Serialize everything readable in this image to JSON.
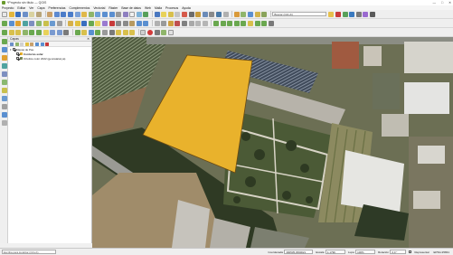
{
  "window": {
    "title": "*Proyecto sin título — QGIS",
    "controls": [
      "—",
      "□",
      "✕"
    ]
  },
  "menu": [
    "Proyecto",
    "Editar",
    "Ver",
    "Capa",
    "Preferencias",
    "Complementos",
    "Vectorial",
    "Ráster",
    "Base de datos",
    "Web",
    "Malla",
    "Procesos",
    "Ayuda"
  ],
  "toolbar": {
    "search_placeholder": "Buscar (Ctrl+K)"
  },
  "panel": {
    "title": "Capas",
    "close": "✕",
    "layers": [
      {
        "name": "Mapas de Pau",
        "checked": true,
        "expanded": true,
        "bold": false,
        "indent": 0,
        "swatch": ""
      },
      {
        "name": "Contorno-solar",
        "checked": true,
        "expanded": false,
        "bold": true,
        "indent": 1,
        "swatch": "#e9b22c"
      },
      {
        "name": "Ortofoto color 2022 (gencatalunya)",
        "checked": true,
        "expanded": false,
        "bold": false,
        "indent": 1,
        "swatch": "#7a8a5a"
      }
    ]
  },
  "map": {
    "polygon_fill": "#e9b22c",
    "polygon_stroke": "#6b4a12"
  },
  "status": {
    "locator_placeholder": "Escriba para localizar (Ctrl+K)",
    "coord_label": "Coordenada",
    "coord_value": "390535,4590021",
    "scale_label": "Escala",
    "scale_value": "1:1799",
    "magnifier_label": "Lupa",
    "magnifier_value": "100%",
    "rotation_label": "Rotación",
    "rotation_value": "0,0 °",
    "render_label": "Representar",
    "crs_value": "EPSG:25831"
  }
}
